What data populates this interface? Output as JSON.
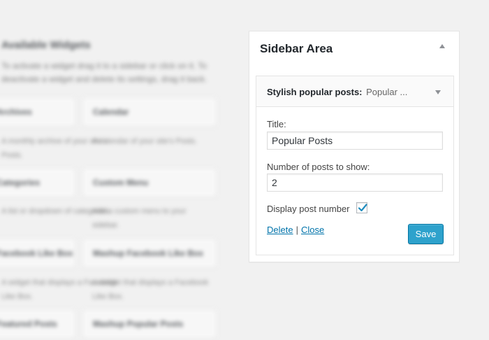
{
  "background": {
    "heading": "Available Widgets",
    "description": "To activate a widget drag it to a sidebar or click on it. To deactivate a widget and delete its settings, drag it back.",
    "widgets": [
      {
        "name": "Archives",
        "caption": "A monthly archive of your site's Posts."
      },
      {
        "name": "Calendar",
        "caption": "A calendar of your site's Posts."
      },
      {
        "name": "Categories",
        "caption": "A list or dropdown of categories."
      },
      {
        "name": "Custom Menu",
        "caption": "Add a custom menu to your sidebar."
      },
      {
        "name": "Facebook Like Box",
        "caption": "A widget that displays a Facebook Like Box."
      },
      {
        "name": "Mashup Facebook Like Box",
        "caption": "A widget that displays a Facebook Like Box."
      },
      {
        "name": "Featured Posts",
        "caption": ""
      },
      {
        "name": "Mashup Popular Posts",
        "caption": ""
      }
    ]
  },
  "sidebar": {
    "title": "Sidebar Area",
    "widget": {
      "name": "Stylish popular posts:",
      "in_title": "Popular ...",
      "fields": {
        "title_label": "Title:",
        "title_value": "Popular Posts",
        "count_label": "Number of posts to show:",
        "count_value": "2",
        "display_number_label": "Display post number",
        "display_number_checked": true
      },
      "actions": {
        "delete_label": "Delete",
        "separator": "|",
        "close_label": "Close",
        "save_label": "Save"
      }
    }
  },
  "colors": {
    "page_bg": "#f1f1f1",
    "link": "#0073aa",
    "primary_button": "#2ea2cc",
    "check_mark": "#1e8cbe"
  }
}
